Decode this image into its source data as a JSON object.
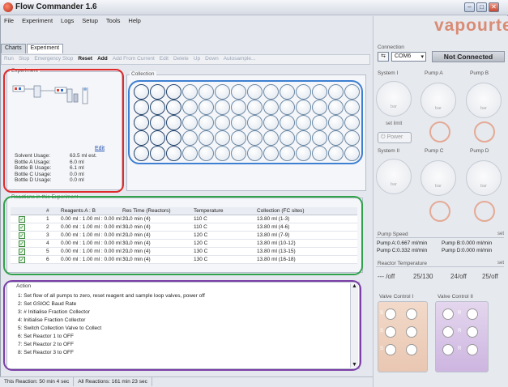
{
  "window": {
    "title": "Flow Commander 1.6"
  },
  "menu": [
    "File",
    "Experiment",
    "Logs",
    "Setup",
    "Tools",
    "Help"
  ],
  "tabs": [
    "Charts",
    "Experiment"
  ],
  "toolbar": {
    "run": "Run",
    "stop": "Stop",
    "emergency_stop": "Emergency Stop",
    "reset": "Reset",
    "add": "Add",
    "add_from_current": "Add From Current",
    "edit": "Edit",
    "delete": "Delete",
    "up": "Up",
    "down": "Down",
    "autosample": "Autosample..."
  },
  "experiment": {
    "group_title": "Experiment",
    "edit_link": "Edit",
    "usage": [
      {
        "label": "Solvent Usage:",
        "value": "63.5 ml est."
      },
      {
        "label": "Bottle A Usage:",
        "value": "6.0 ml"
      },
      {
        "label": "Bottle B Usage:",
        "value": "6.1 ml"
      },
      {
        "label": "Bottle C Usage:",
        "value": "0.0 ml"
      },
      {
        "label": "Bottle D Usage:",
        "value": "0.0 ml"
      }
    ]
  },
  "collection": {
    "group_title": "Collection",
    "rows": 5,
    "cols": 14,
    "filled": [
      3,
      3,
      3,
      3,
      3
    ]
  },
  "reactions": {
    "group_title": "Reactions in this Experiment",
    "headers": [
      "#",
      "Reagents A : B",
      "Res Time (Reactors)",
      "Temperature",
      "Collection (FC sites)"
    ],
    "rows": [
      {
        "n": "1",
        "reagents": "0.00 ml : 1.00 ml : 0.00 ml : ...",
        "res_time": "20.0 min (4)",
        "temp": "110 C",
        "collection": "13.80 ml (1-3)"
      },
      {
        "n": "2",
        "reagents": "0.00 ml : 1.00 ml : 0.00 ml : ...",
        "res_time": "30.0 min (4)",
        "temp": "110 C",
        "collection": "13.80 ml (4-6)"
      },
      {
        "n": "3",
        "reagents": "0.00 ml : 1.00 ml : 0.00 ml : ...",
        "res_time": "20.0 min (4)",
        "temp": "120 C",
        "collection": "13.80 ml (7-9)"
      },
      {
        "n": "4",
        "reagents": "0.00 ml : 1.00 ml : 0.00 ml : ...",
        "res_time": "30.0 min (4)",
        "temp": "120 C",
        "collection": "13.80 ml (10-12)"
      },
      {
        "n": "5",
        "reagents": "0.00 ml : 1.00 ml : 0.00 ml : ...",
        "res_time": "20.0 min (4)",
        "temp": "130 C",
        "collection": "13.80 ml (13-15)"
      },
      {
        "n": "6",
        "reagents": "0.00 ml : 1.00 ml : 0.00 ml : ...",
        "res_time": "30.0 min (4)",
        "temp": "130 C",
        "collection": "13.80 ml (16-18)"
      }
    ]
  },
  "actions": {
    "header": "Action",
    "items": [
      "1: Set flow of all pumps to zero, reset reagent and sample loop valves, power off",
      "2: Set GSIOC Baud Rate",
      "3: # Initialise Fraction Collector",
      "4: Initialise Fraction Collector",
      "5: Switch Collection Valve to Collect",
      "6: Set Reactor 1 to OFF",
      "7: Set Reactor 2 to OFF",
      "8: Set Reactor 3 to OFF"
    ]
  },
  "status": {
    "this_reaction": "This Reaction: 50 min 4 sec",
    "all_reactions": "All Reactions: 161 min 23 sec"
  },
  "right_panel": {
    "logo": "vapourtec",
    "connection_title": "Connection",
    "port": "COM6",
    "connection_status": "Not Connected",
    "system1": "System I",
    "system2": "System II",
    "pump_a": "Pump A",
    "pump_b": "Pump B",
    "pump_c": "Pump C",
    "pump_d": "Pump D",
    "set_limit": "set limit",
    "power": "Power",
    "bar_unit": "bar",
    "pump_speed_title": "Pump Speed",
    "set": "set",
    "pump_speeds": [
      {
        "label": "Pump A:",
        "value": "0.667 ml/min"
      },
      {
        "label": "Pump B:",
        "value": "0.000 ml/min"
      },
      {
        "label": "Pump C:",
        "value": "0.332 ml/min"
      },
      {
        "label": "Pump D:",
        "value": "0.000 ml/min"
      }
    ],
    "reactor_temp_title": "Reactor Temperature",
    "reactor_temps": [
      "--- /off",
      "25/130",
      "24/off",
      "25/off"
    ],
    "valve_control_1": "Valve Control I",
    "valve_control_2": "Valve Control II",
    "valve_letters": [
      "S",
      "R",
      "S",
      "R",
      "S",
      "R"
    ]
  },
  "colors": {
    "red": "#e02a2a",
    "blue": "#3d7fd1",
    "green": "#2fa24a",
    "purple": "#7b3fa6",
    "accent": "#d98b75"
  }
}
